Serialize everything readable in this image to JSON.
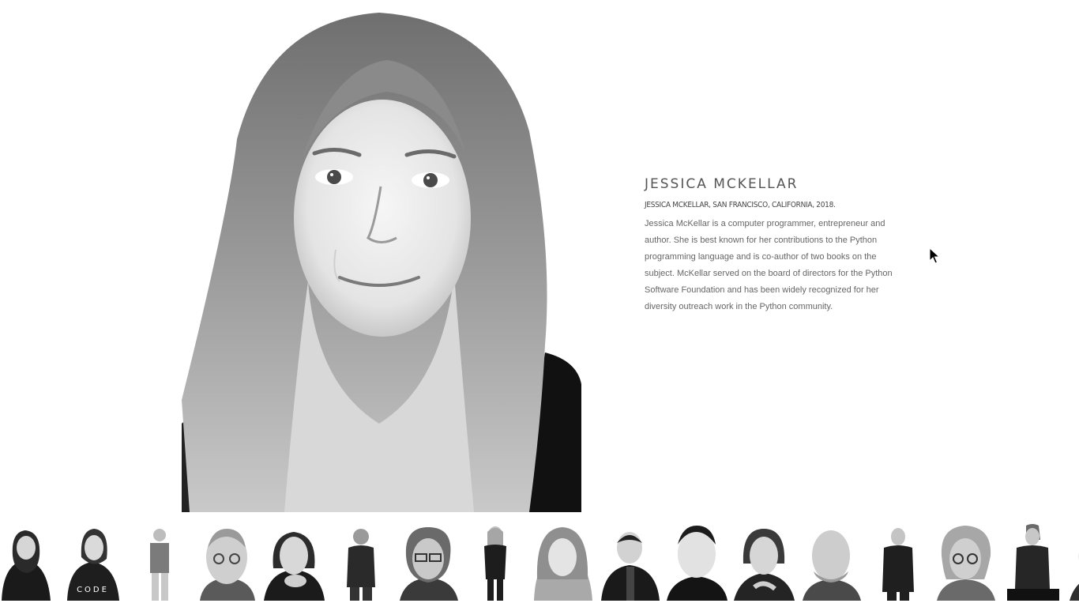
{
  "featured": {
    "name": "JESSICA MCKELLAR",
    "caption": "JESSICA MCKELLAR, SAN FRANCISCO, CALIFORNIA, 2018.",
    "description": "Jessica McKellar is a computer programmer, entrepreneur and author. She is best known for her contributions to the Python programming language and is co-author of two books on the subject. McKellar served on the board of directors for the Python Software Foundation and has been widely recognized for her diversity outreach work in the Python community."
  },
  "thumbnails": [
    {
      "id": "t1",
      "style": "half-body-dark"
    },
    {
      "id": "t2",
      "style": "half-body-dark",
      "shirt_text": "CODE"
    },
    {
      "id": "t3",
      "style": "full-body-small"
    },
    {
      "id": "t4",
      "style": "close-up"
    },
    {
      "id": "t5",
      "style": "close-up-dark"
    },
    {
      "id": "t6",
      "style": "full-body-small"
    },
    {
      "id": "t7",
      "style": "close-up"
    },
    {
      "id": "t8",
      "style": "full-body-small"
    },
    {
      "id": "t9",
      "style": "close-up"
    },
    {
      "id": "t10",
      "style": "half-body-dark"
    },
    {
      "id": "t11",
      "style": "close-up-dark"
    },
    {
      "id": "t12",
      "style": "close-up-dark"
    },
    {
      "id": "t13",
      "style": "close-up"
    },
    {
      "id": "t14",
      "style": "full-body-small"
    },
    {
      "id": "t15",
      "style": "close-up"
    },
    {
      "id": "t16",
      "style": "half-body-dark"
    },
    {
      "id": "t17",
      "style": "close-up-dark"
    }
  ],
  "colors": {
    "background": "#ffffff",
    "name_text": "#555555",
    "caption_text": "#444444",
    "body_text": "#666666"
  },
  "icons": {
    "cursor": "arrow-cursor-icon"
  }
}
